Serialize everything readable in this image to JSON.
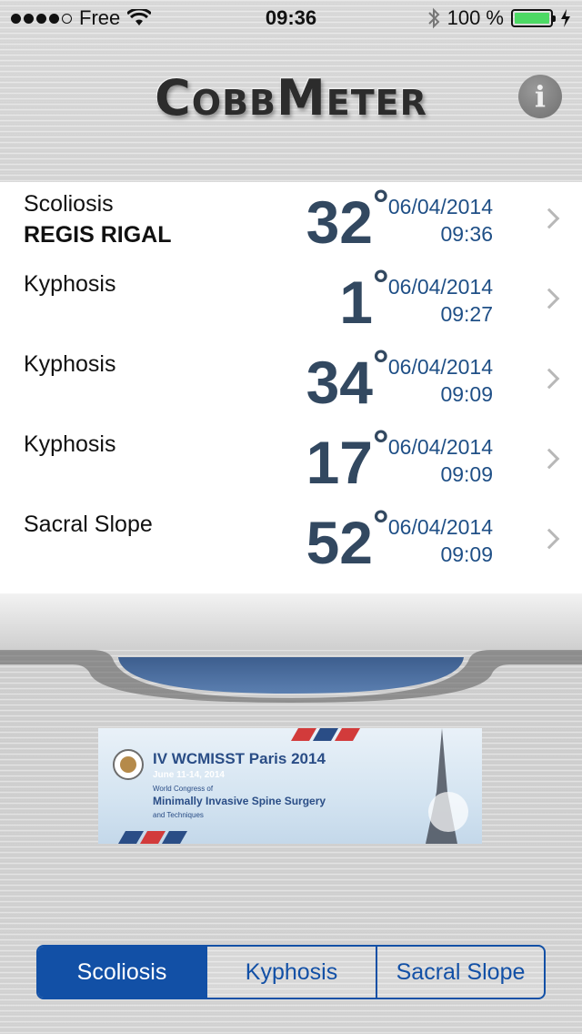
{
  "status_bar": {
    "carrier": "Free",
    "time": "09:36",
    "battery_percent": "100 %",
    "signal_bars_filled": 4,
    "signal_bars_total": 5
  },
  "header": {
    "app_title": "CobbMeter",
    "info_label": "i"
  },
  "measurements": [
    {
      "type": "Scoliosis",
      "name": "REGIS RIGAL",
      "angle": "32",
      "date": "06/04/2014",
      "time": "09:36"
    },
    {
      "type": "Kyphosis",
      "name": "",
      "angle": "1",
      "date": "06/04/2014",
      "time": "09:27"
    },
    {
      "type": "Kyphosis",
      "name": "",
      "angle": "34",
      "date": "06/04/2014",
      "time": "09:09"
    },
    {
      "type": "Kyphosis",
      "name": "",
      "angle": "17",
      "date": "06/04/2014",
      "time": "09:09"
    },
    {
      "type": "Sacral Slope",
      "name": "",
      "angle": "52",
      "date": "06/04/2014",
      "time": "09:09"
    }
  ],
  "degree_symbol": "°",
  "banner": {
    "title": "IV WCMISST Paris 2014",
    "dates": "June 11-14, 2014",
    "line1": "World Congress of",
    "line2": "Minimally Invasive Spine Surgery",
    "line3": "and Techniques"
  },
  "segments": {
    "items": [
      "Scoliosis",
      "Kyphosis",
      "Sacral Slope"
    ],
    "selected_index": 0
  },
  "colors": {
    "accent": "#1250a6",
    "angle_text": "#324860",
    "date_text": "#1f4f86",
    "battery": "#4cd964"
  }
}
